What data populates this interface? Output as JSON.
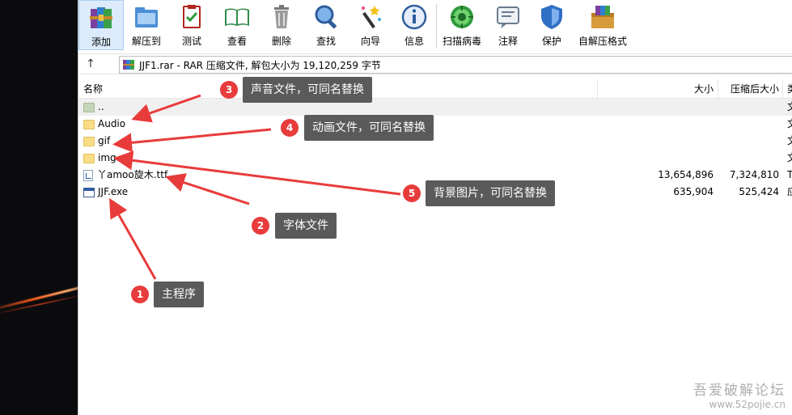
{
  "window": {
    "address": "JJF1.rar - RAR 压缩文件, 解包大小为 19,120,259 字节"
  },
  "toolbar": [
    {
      "label": "添加",
      "icon": "add-archive-icon"
    },
    {
      "label": "解压到",
      "icon": "extract-to-icon"
    },
    {
      "label": "测试",
      "icon": "test-icon"
    },
    {
      "label": "查看",
      "icon": "view-icon"
    },
    {
      "label": "删除",
      "icon": "delete-icon"
    },
    {
      "label": "查找",
      "icon": "find-icon"
    },
    {
      "label": "向导",
      "icon": "wizard-icon"
    },
    {
      "label": "信息",
      "icon": "info-icon"
    },
    {
      "label": "扫描病毒",
      "icon": "virus-scan-icon"
    },
    {
      "label": "注释",
      "icon": "comment-icon"
    },
    {
      "label": "保护",
      "icon": "protect-icon"
    },
    {
      "label": "自解压格式",
      "icon": "sfx-icon"
    }
  ],
  "columns": {
    "name": "名称",
    "size": "大小",
    "packed": "压缩后大小",
    "type": "类"
  },
  "files": [
    {
      "name": "..",
      "size": "",
      "packed": "",
      "type": "文",
      "kind": "parent"
    },
    {
      "name": "Audio",
      "size": "",
      "packed": "",
      "type": "文",
      "kind": "folder"
    },
    {
      "name": "gif",
      "size": "",
      "packed": "",
      "type": "文",
      "kind": "folder"
    },
    {
      "name": "img",
      "size": "",
      "packed": "",
      "type": "文",
      "kind": "folder"
    },
    {
      "name": "丫amoo旋木.ttf",
      "size": "13,654,896",
      "packed": "7,324,810",
      "type": "T",
      "kind": "font"
    },
    {
      "name": "JJF.exe",
      "size": "635,904",
      "packed": "525,424",
      "type": "应",
      "kind": "exe"
    }
  ],
  "annotations": [
    {
      "num": "1",
      "text": "主程序"
    },
    {
      "num": "2",
      "text": "字体文件"
    },
    {
      "num": "3",
      "text": "声音文件，可同名替换"
    },
    {
      "num": "4",
      "text": "动画文件，可同名替换"
    },
    {
      "num": "5",
      "text": "背景图片，可同名替换"
    }
  ],
  "watermark": {
    "line1": "吾爱破解论坛",
    "line2": "www.52pojie.cn"
  }
}
